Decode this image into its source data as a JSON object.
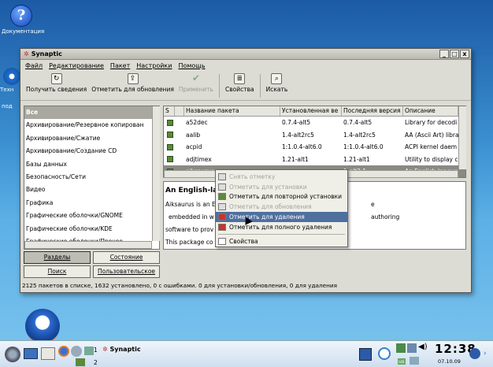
{
  "desktop": {
    "icon1_label": "Документация",
    "icon2_label": "Техн",
    "icon3_label": "под"
  },
  "window": {
    "title": "Synaptic",
    "min": "_",
    "max": "□",
    "close": "x"
  },
  "menu": [
    "Файл",
    "Редактирование",
    "Пакет",
    "Настройки",
    "Помощь"
  ],
  "toolbar": {
    "reload": "Получить сведения",
    "mark_updates": "Отметить для обновления",
    "apply": "Применить",
    "properties": "Свойства",
    "search": "Искать"
  },
  "categories": [
    "Все",
    "Архивирование/Резервное копирован",
    "Архивирование/Сжатие",
    "Архивирование/Создание CD",
    "Базы данных",
    "Безопасность/Сети",
    "Видео",
    "Графика",
    "Графические оболочки/GNOME",
    "Графические оболочки/KDE",
    "Графические оболочки/Прочее"
  ],
  "filter_buttons": {
    "sections": "Разделы",
    "status": "Состояние",
    "search": "Поиск",
    "custom": "Пользовательское"
  },
  "table": {
    "headers": [
      "S",
      "Название пакета",
      "Установленная ве",
      "Последняя версия",
      "Описание"
    ],
    "rows": [
      {
        "name": "a52dec",
        "installed": "0.7.4-alt5",
        "latest": "0.7.4-alt5",
        "desc": "Library for decodi"
      },
      {
        "name": "aalib",
        "installed": "1.4-alt2rc5",
        "latest": "1.4-alt2rc5",
        "desc": "AA (Ascii Art) libra"
      },
      {
        "name": "acpid",
        "installed": "1:1.0.4-alt6.0",
        "latest": "1:1.0.4-alt6.0",
        "desc": "ACPI kernel daem"
      },
      {
        "name": "adjtimex",
        "installed": "1.21-alt1",
        "latest": "1.21-alt1",
        "desc": "Utility to display c"
      },
      {
        "name": "aiksaurus",
        "installed": "",
        "latest": "1-alt2.1",
        "desc": "An English-langua"
      }
    ]
  },
  "description": {
    "title": "An English-la",
    "line1": "Aiksaurus is an E",
    "line1_tail": "e",
    "line2": "embedded in w",
    "line2_tail": "authoring",
    "line3": "software to prov",
    "line4": "This package co"
  },
  "context_menu": [
    "Снять отметку",
    "Отметить для установки",
    "Отметить для повторной установки",
    "Отметить для обновления",
    "Отметить для удаления",
    "Отметить для полного удаления",
    "Свойства"
  ],
  "statusbar": "2125 пакетов в списке, 1632 установлено, 0 с ошибками. 0 для установки/обновления, 0 для удаления",
  "taskbar": {
    "task_label": "Synaptic",
    "desk1": "1",
    "desk2": "2",
    "clock": "12:38",
    "date": "07.10.09",
    "lang": "us"
  }
}
